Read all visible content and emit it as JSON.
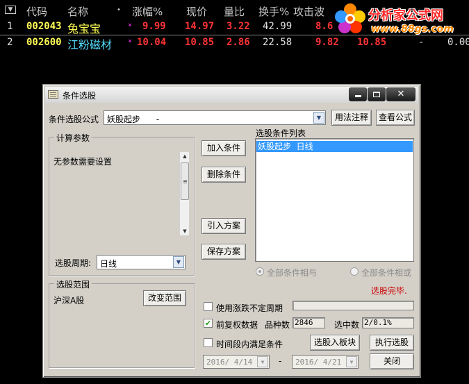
{
  "table": {
    "sort_icon": "dropdown-triangle-icon",
    "columns": [
      "代码",
      "名称",
      "•",
      "涨幅%",
      "现价",
      "量比",
      "换手%",
      "攻击波"
    ],
    "rows": [
      {
        "idx": "1",
        "code": "002043",
        "name": "兔宝宝",
        "star": "×",
        "change": "9.99",
        "price": "14.97",
        "vol_ratio": "3.22",
        "turnover": "42.99",
        "attack": "8.6"
      },
      {
        "idx": "2",
        "code": "002600",
        "name": "江粉磁材",
        "star": "×",
        "change": "10.04",
        "price": "10.85",
        "vol_ratio": "2.86",
        "turnover": "22.58",
        "attack": "9.82",
        "extra1": "10.85",
        "extra2": "-",
        "extra3": "0.00"
      }
    ],
    "colors": {
      "header": "#c8c8c8",
      "code": "#ffff55",
      "name1": "#ffff55",
      "name2": "#55ddff",
      "up": "#ff3333",
      "white": "#e0e0e0",
      "star": "#ff33ff"
    }
  },
  "watermark": {
    "line1": "分析家公式网",
    "line2": "www.88gs.com"
  },
  "dialog": {
    "title": "条件选股",
    "formula_label": "条件选股公式",
    "formula_value": "妖股起步      -",
    "usage_button": "用法注释",
    "view_button": "查看公式",
    "params_group": "计算参数",
    "params_text": "无参数需要设置",
    "period_label": "选股周期:",
    "period_value": "日线",
    "add_button": "加入条件",
    "delete_button": "删除条件",
    "import_button": "引入方案",
    "save_button": "保存方案",
    "cond_list_label": "选股条件列表",
    "cond_items": [
      "妖股起步  日线"
    ],
    "radio_and": "全部条件相与",
    "radio_or": "全部条件相或",
    "status": "选股完毕.",
    "scope_group": "选股范围",
    "scope_value": "沪深A股",
    "change_scope_button": "改变范围",
    "use_period_label": "使用涨跌不定周期",
    "use_period_checked": false,
    "pre_adjust_label": "前复权数据",
    "pre_adjust_checked": true,
    "varieties_label": "品种数",
    "varieties_value": "2846",
    "selected_label": "选中数",
    "selected_value": "2/0.1%",
    "time_range_label": "时间段内满足条件",
    "time_range_checked": false,
    "date_from": "2016/ 4/14",
    "date_to": "2016/ 4/21",
    "date_sep": "-",
    "to_block_button": "选股入板块",
    "run_button": "执行选股",
    "close_button": "关闭",
    "status_color": "#cc0000",
    "selection_color": "#3399ff"
  }
}
